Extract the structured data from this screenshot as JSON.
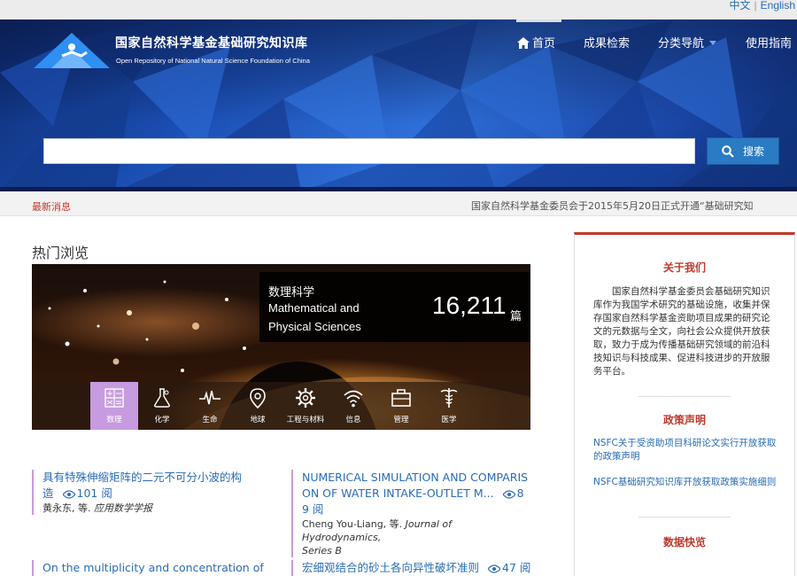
{
  "lang": {
    "zh": "中文",
    "en": "English"
  },
  "site": {
    "title": "国家自然科学基金基础研究知识库",
    "subtitle": "Open Repository of National Natural Science Foundation of China"
  },
  "nav": {
    "home": "首页",
    "search": "成果检索",
    "categories": "分类导航",
    "guide": "使用指南"
  },
  "search": {
    "value": "",
    "placeholder": "",
    "button": "搜索"
  },
  "news": {
    "label": "最新消息",
    "text": "国家自然科学基金委员会于2015年5月20日正式开通“基础研究知"
  },
  "hot": {
    "title": "热门浏览",
    "banner": {
      "cn": "数理科学",
      "en_line1": "Mathematical and",
      "en_line2": "Physical Sciences",
      "count": "16,211",
      "unit": "篇"
    },
    "categories": [
      {
        "label": "数理",
        "icon": "math-icon"
      },
      {
        "label": "化学",
        "icon": "chemistry-icon"
      },
      {
        "label": "生命",
        "icon": "pulse-icon"
      },
      {
        "label": "地球",
        "icon": "location-pin-icon"
      },
      {
        "label": "工程与材料",
        "icon": "gear-icon"
      },
      {
        "label": "信息",
        "icon": "wifi-icon"
      },
      {
        "label": "管理",
        "icon": "briefcase-icon"
      },
      {
        "label": "医学",
        "icon": "caduceus-icon"
      }
    ]
  },
  "articles": [
    {
      "title_line1": "具有特殊伸缩矩阵的二元不可分小波的构",
      "title_line2": "造",
      "views": "101 阅",
      "authors": "黄永东, 等.",
      "journal": "应用数学学报"
    },
    {
      "title_line1": "NUMERICAL SIMULATION AND COMPARIS",
      "title_line2": "ON OF WATER INTAKE-OUTLET M...",
      "views_a": "8",
      "views_b": "9 阅",
      "authors": "Cheng You-Liang, 等.",
      "journal": "Journal of Hydrodynamics,",
      "journal2": "Series B"
    },
    {
      "title_line1": "On the multiplicity and concentration of p"
    },
    {
      "title_line1": "宏细观结合的砂土各向异性破坏准则",
      "views": "47 阅"
    }
  ],
  "sidebar": {
    "about_title": "关于我们",
    "about_text": "国家自然科学基金委员会基础研究知识库作为我国学术研究的基础设施，收集并保存国家自然科学基金资助项目成果的研究论文的元数据与全文，向社会公众提供开放获取，致力于成为传播基础研究领域的前沿科技知识与科技成果、促进科技进步的开放服务平台。",
    "policy_title": "政策声明",
    "policy_links": [
      "NSFC关于受资助项目科研论文实行开放获取的政策声明",
      "NSFC基础研究知识库开放获取政策实施细则"
    ],
    "data_title": "数据快览"
  },
  "colors": {
    "accent_red": "#c0392b",
    "link_blue": "#2a6cb5",
    "active_category": "#c79be0",
    "search_button": "#2a7ac4"
  }
}
